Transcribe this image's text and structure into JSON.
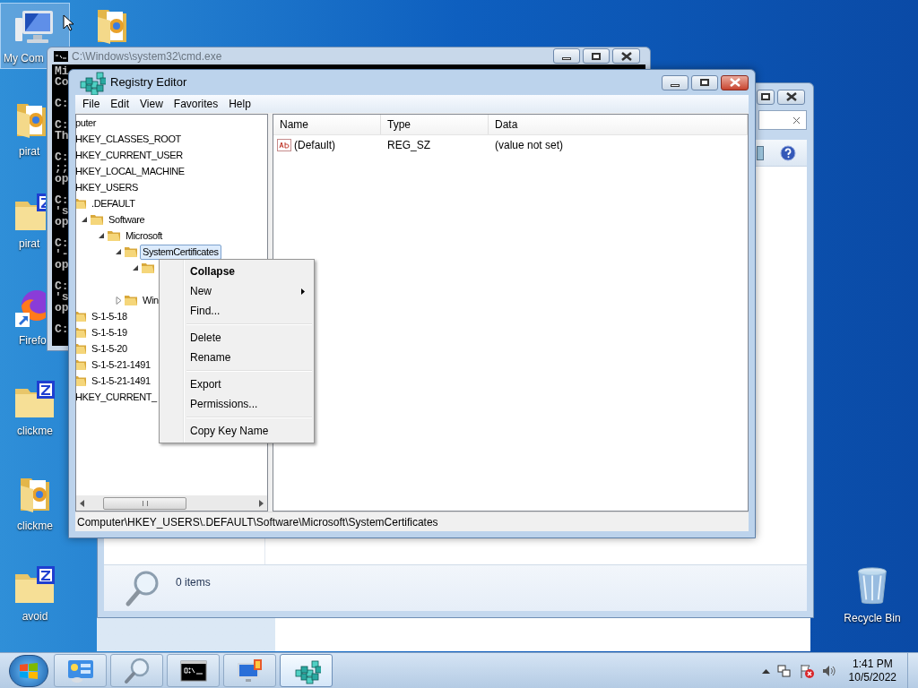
{
  "desktop": {
    "icons": [
      {
        "kind": "computer",
        "label": "My Com",
        "selected": true
      },
      {
        "kind": "doc_folder",
        "selected": false
      },
      {
        "kind": "doc_folder",
        "label": "pirat",
        "selected": false
      },
      {
        "kind": "zip_folder",
        "label": "pirat",
        "selected": false
      },
      {
        "kind": "browser",
        "label": "Firefo",
        "selected": false
      },
      {
        "kind": "zip_folder",
        "label": "clickme",
        "selected": false
      },
      {
        "kind": "doc_folder",
        "label": "clickme",
        "selected": false
      },
      {
        "kind": "zip_folder",
        "label": "avoid",
        "selected": false
      },
      {
        "kind": "bin",
        "label": "Recycle Bin",
        "selected": false
      }
    ]
  },
  "cmd_window": {
    "title": "C:\\Windows\\system32\\cmd.exe",
    "paragraphs": [
      [
        "Mi",
        "Co"
      ],
      [
        "C:"
      ],
      [
        "C:",
        "Th"
      ],
      [
        "C:",
        ";;",
        "op"
      ],
      [
        "C:",
        "'s",
        "op"
      ],
      [
        "C:",
        "'-",
        "op"
      ],
      [
        "C:",
        "'s",
        "op"
      ],
      [
        "C:"
      ]
    ]
  },
  "explorer_window": {
    "status": "0 items"
  },
  "registry_editor": {
    "title": "Registry Editor",
    "menu": [
      "File",
      "Edit",
      "View",
      "Favorites",
      "Help"
    ],
    "tree": [
      {
        "label": "puter",
        "selected": false,
        "children": [
          {
            "label": "HKEY_CLASSES_ROOT",
            "selected": false
          },
          {
            "label": "HKEY_CURRENT_USER",
            "selected": false
          },
          {
            "label": "HKEY_LOCAL_MACHINE",
            "selected": false
          },
          {
            "label": "HKEY_USERS",
            "selected": false,
            "children": [
              {
                "label": ".DEFAULT",
                "selected": false,
                "children": [
                  {
                    "label": "Software",
                    "selected": false,
                    "expanded": true,
                    "children": [
                      {
                        "label": "Microsoft",
                        "selected": false,
                        "expanded": true,
                        "children": [
                          {
                            "label": "SystemCertificates",
                            "selected": true,
                            "expanded": true,
                            "children": [
                              {
                                "selected": false,
                                "expanded": true
                              }
                            ]
                          },
                          {
                            "label": "Win",
                            "selected": false,
                            "expanded": false
                          }
                        ]
                      }
                    ]
                  }
                ]
              },
              {
                "label": "S-1-5-18",
                "selected": false
              },
              {
                "label": "S-1-5-19",
                "selected": false
              },
              {
                "label": "S-1-5-20",
                "selected": false
              },
              {
                "label": "S-1-5-21-1491",
                "selected": false
              },
              {
                "label": "S-1-5-21-1491",
                "selected": false
              }
            ]
          },
          {
            "label": "HKEY_CURRENT_",
            "selected": false
          }
        ]
      }
    ],
    "columns": [
      "Name",
      "Type",
      "Data"
    ],
    "rows": [
      {
        "name": "(Default)",
        "type": "REG_SZ",
        "data": "(value not set)"
      }
    ],
    "status_bar": "Computer\\HKEY_USERS\\.DEFAULT\\Software\\Microsoft\\SystemCertificates"
  },
  "context_menu": [
    [
      {
        "label": "Collapse",
        "bold": true,
        "submenu": false
      },
      {
        "label": "New",
        "bold": false,
        "submenu": true
      },
      {
        "label": "Find...",
        "bold": false,
        "submenu": false
      }
    ],
    [
      {
        "label": "Delete",
        "bold": false,
        "submenu": false
      },
      {
        "label": "Rename",
        "bold": false,
        "submenu": false
      }
    ],
    [
      {
        "label": "Export",
        "bold": false,
        "submenu": false
      },
      {
        "label": "Permissions...",
        "bold": false,
        "submenu": false
      }
    ],
    [
      {
        "label": "Copy Key Name",
        "bold": false,
        "submenu": false
      }
    ]
  ],
  "taskbar": {
    "buttons": [
      {
        "kind": "control_panel",
        "selected": false
      },
      {
        "kind": "search",
        "selected": false
      },
      {
        "kind": "console",
        "selected": false
      },
      {
        "kind": "computer",
        "selected": false
      },
      {
        "kind": "registry",
        "selected": true
      }
    ],
    "time": "1:41 PM",
    "date": "10/5/2022"
  }
}
